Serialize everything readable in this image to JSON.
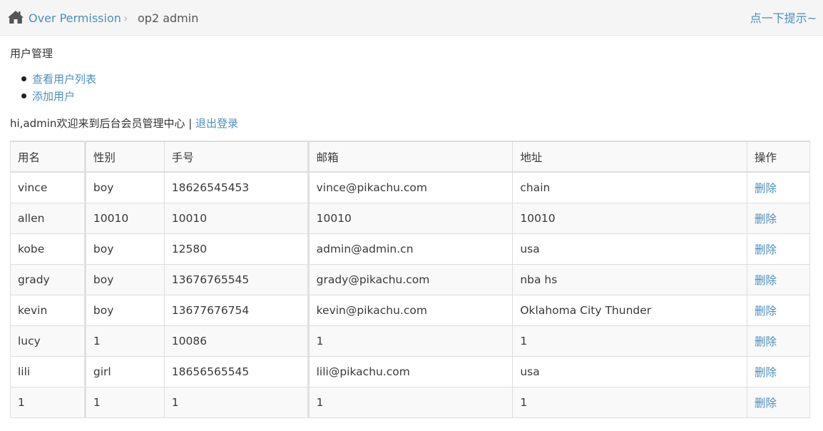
{
  "breadcrumb": {
    "home_icon": "home-icon",
    "parent": "Over Permission",
    "separator": "›",
    "current": "op2 admin"
  },
  "hint": "点一下提示~",
  "section_title": "用户管理",
  "menu": [
    {
      "label": "查看用户列表"
    },
    {
      "label": "添加用户"
    }
  ],
  "welcome": {
    "text": "hi,admin欢迎来到后台会员管理中心 | ",
    "logout": "退出登录"
  },
  "table": {
    "headers": [
      "用名",
      "性别",
      "手号",
      "邮箱",
      "地址",
      "操作"
    ],
    "rows": [
      [
        "vince",
        "boy",
        "18626545453",
        "vince@pikachu.com",
        "chain",
        "删除"
      ],
      [
        "allen",
        "10010",
        "10010",
        "10010",
        "10010",
        "删除"
      ],
      [
        "kobe",
        "boy",
        "12580",
        "admin@admin.cn",
        "usa",
        "删除"
      ],
      [
        "grady",
        "boy",
        "13676765545",
        "grady@pikachu.com",
        "nba hs",
        "删除"
      ],
      [
        "kevin",
        "boy",
        "13677676754",
        "kevin@pikachu.com",
        "Oklahoma City Thunder",
        "删除"
      ],
      [
        "lucy",
        "1",
        "10086",
        "1",
        "1",
        "删除"
      ],
      [
        "lili",
        "girl",
        "18656565545",
        "lili@pikachu.com",
        "usa",
        "删除"
      ],
      [
        "1",
        "1",
        "1",
        "1",
        "1",
        "删除"
      ]
    ]
  },
  "colors": {
    "link": "#4c8fbd",
    "topbar_bg": "#f5f5f5",
    "row_alt_bg": "#f9f9f9"
  }
}
